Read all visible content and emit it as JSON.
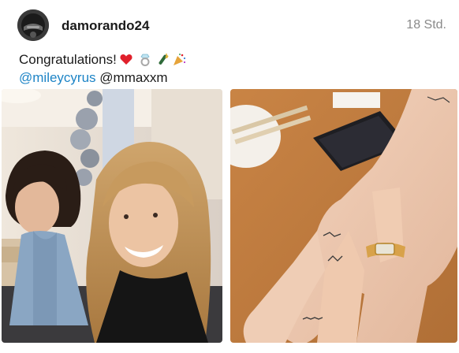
{
  "post": {
    "username": "damorando24",
    "time": "18 Std.",
    "caption_text": "Congratulations!",
    "caption_emojis": [
      "heart-icon",
      "ring-icon",
      "champagne-icon",
      "party-popper-icon"
    ],
    "mention_1": "@mileycyrus",
    "mention_2": "@mmaxxm"
  },
  "images": [
    {
      "name": "photo-couple-at-table"
    },
    {
      "name": "photo-hand-with-ring"
    }
  ],
  "colors": {
    "mention": "#1d84c6",
    "username": "#1a1a1a",
    "time": "#8a8a8a"
  }
}
